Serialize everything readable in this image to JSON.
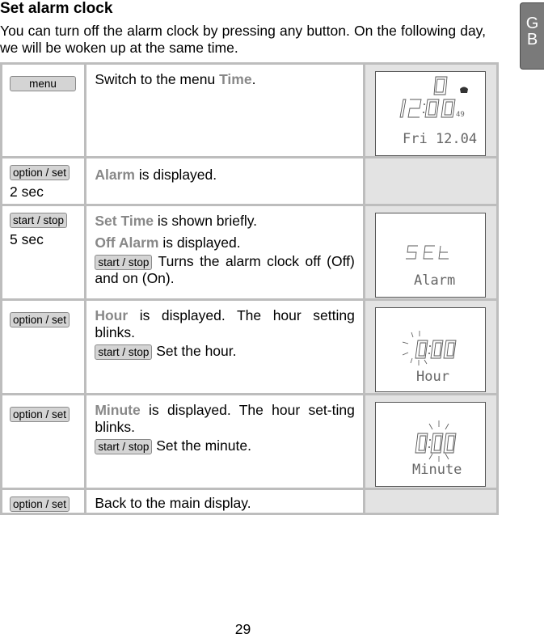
{
  "page": {
    "title": "Set alarm clock",
    "intro": "You can turn off the alarm clock by pressing any button. On the following day, we will be woken up at the same time.",
    "language_tab": [
      "G",
      "B"
    ],
    "page_number": "29"
  },
  "steps": [
    {
      "key_button": "menu",
      "duration": "",
      "lines": [
        {
          "highlight": "",
          "before": "Switch to the menu ",
          "after": "."
        },
        {
          "hl_word": "Time"
        }
      ],
      "display": {
        "type": "clock",
        "top_digit": "0",
        "time": "12:00",
        "seconds": "49",
        "date": "Fri 12.04"
      }
    },
    {
      "key_button": "option / set",
      "duration": "2 sec",
      "text_hl": "Alarm",
      "text": " is displayed.",
      "display": null
    },
    {
      "key_button": "start / stop",
      "duration": "5 sec",
      "line1_hl": "Set Time",
      "line1": " is shown briefly.",
      "line2_hl": "Off Alarm",
      "line2": " is displayed.",
      "line3_button": "start / stop",
      "line3": " Turns the alarm clock off (Off) and on (On).",
      "display": {
        "type": "text",
        "segment_text": "SEt",
        "label": "Alarm"
      }
    },
    {
      "key_button": "option / set",
      "line1_hl": "Hour",
      "line1": " is displayed. The hour setting blinks.",
      "line2_button": "start / stop",
      "line2": " Set the hour.",
      "display": {
        "type": "blink-hour",
        "digits": "0:00",
        "label": "Hour"
      }
    },
    {
      "key_button": "option / set",
      "line1_hl": "Minute",
      "line1": " is displayed. The hour set-ting blinks.",
      "line2_button": "start / stop",
      "line2": " Set the minute.",
      "display": {
        "type": "blink-minute",
        "digits": "0:00",
        "label": "Minute"
      }
    },
    {
      "key_button": "option / set",
      "text": "Back to the main display.",
      "display": null
    }
  ],
  "row1_text_before": "Switch to the menu ",
  "row1_text_hl": "Time",
  "row1_text_after": ".",
  "colors": {
    "highlight": "#888888",
    "border": "#bdbdbd",
    "display_cell_bg": "#e3e3e3",
    "button_bg": "#d4d4d4",
    "lang_tab_bg": "#7a7a7a"
  }
}
